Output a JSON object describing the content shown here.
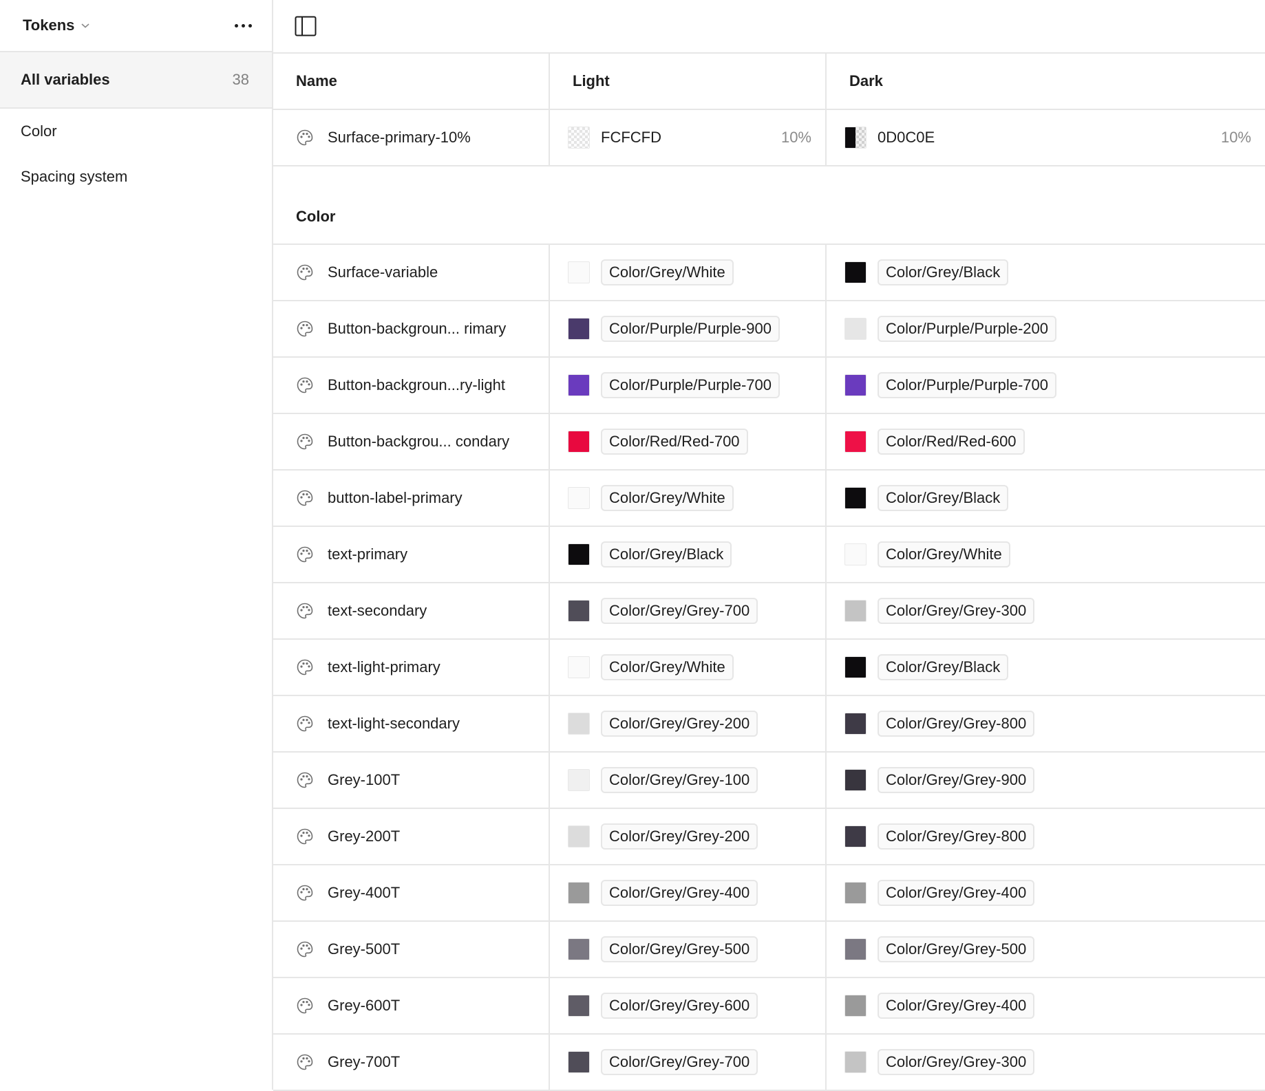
{
  "sidebar": {
    "collection_name": "Tokens",
    "all_variables": {
      "label": "All variables",
      "count": "38"
    },
    "groups": [
      "Color",
      "Spacing system"
    ]
  },
  "table": {
    "columns": {
      "name": "Name",
      "light": "Light",
      "dark": "Dark"
    },
    "ungrouped": [
      {
        "name": "Surface-primary-10%",
        "light": {
          "hex": "FCFCFD",
          "opacity": "10%"
        },
        "dark": {
          "hex": "0D0C0E",
          "opacity": "10%"
        }
      }
    ],
    "section_title": "Color",
    "rows": [
      {
        "name": "Surface-variable",
        "light": {
          "ref": "Color/Grey/White",
          "color": "#fafafa"
        },
        "dark": {
          "ref": "Color/Grey/Black",
          "color": "#0d0c0e"
        }
      },
      {
        "name": "Button-backgroun...  rimary",
        "light": {
          "ref": "Color/Purple/Purple-900",
          "color": "#4a3a6b"
        },
        "dark": {
          "ref": "Color/Purple/Purple-200",
          "color": "#e6e6e6"
        }
      },
      {
        "name": "Button-backgroun...ry-light",
        "light": {
          "ref": "Color/Purple/Purple-700",
          "color": "#6a3bbe"
        },
        "dark": {
          "ref": "Color/Purple/Purple-700",
          "color": "#6a3bbe"
        }
      },
      {
        "name": "Button-backgrou... condary",
        "light": {
          "ref": "Color/Red/Red-700",
          "color": "#e8093f"
        },
        "dark": {
          "ref": "Color/Red/Red-600",
          "color": "#ee1147"
        }
      },
      {
        "name": "button-label-primary",
        "light": {
          "ref": "Color/Grey/White",
          "color": "#fafafa"
        },
        "dark": {
          "ref": "Color/Grey/Black",
          "color": "#0d0c0e"
        }
      },
      {
        "name": "text-primary",
        "light": {
          "ref": "Color/Grey/Black",
          "color": "#0d0c0e"
        },
        "dark": {
          "ref": "Color/Grey/White",
          "color": "#fafafa"
        }
      },
      {
        "name": "text-secondary",
        "light": {
          "ref": "Color/Grey/Grey-700",
          "color": "#504d58"
        },
        "dark": {
          "ref": "Color/Grey/Grey-300",
          "color": "#c4c4c4"
        }
      },
      {
        "name": "text-light-primary",
        "light": {
          "ref": "Color/Grey/White",
          "color": "#fafafa"
        },
        "dark": {
          "ref": "Color/Grey/Black",
          "color": "#0d0c0e"
        }
      },
      {
        "name": "text-light-secondary",
        "light": {
          "ref": "Color/Grey/Grey-200",
          "color": "#dcdcdc"
        },
        "dark": {
          "ref": "Color/Grey/Grey-800",
          "color": "#3e3a46"
        }
      },
      {
        "name": "Grey-100T",
        "light": {
          "ref": "Color/Grey/Grey-100",
          "color": "#f0f0f0"
        },
        "dark": {
          "ref": "Color/Grey/Grey-900",
          "color": "#38353e"
        }
      },
      {
        "name": "Grey-200T",
        "light": {
          "ref": "Color/Grey/Grey-200",
          "color": "#dcdcdc"
        },
        "dark": {
          "ref": "Color/Grey/Grey-800",
          "color": "#3e3a46"
        }
      },
      {
        "name": "Grey-400T",
        "light": {
          "ref": "Color/Grey/Grey-400",
          "color": "#9a9a9a"
        },
        "dark": {
          "ref": "Color/Grey/Grey-400",
          "color": "#9a9a9a"
        }
      },
      {
        "name": "Grey-500T",
        "light": {
          "ref": "Color/Grey/Grey-500",
          "color": "#7b7882"
        },
        "dark": {
          "ref": "Color/Grey/Grey-500",
          "color": "#7b7882"
        }
      },
      {
        "name": "Grey-600T",
        "light": {
          "ref": "Color/Grey/Grey-600",
          "color": "#5f5c66"
        },
        "dark": {
          "ref": "Color/Grey/Grey-400",
          "color": "#9a9a9a"
        }
      },
      {
        "name": "Grey-700T",
        "light": {
          "ref": "Color/Grey/Grey-700",
          "color": "#504d58"
        },
        "dark": {
          "ref": "Color/Grey/Grey-300",
          "color": "#c4c4c4"
        }
      }
    ]
  }
}
